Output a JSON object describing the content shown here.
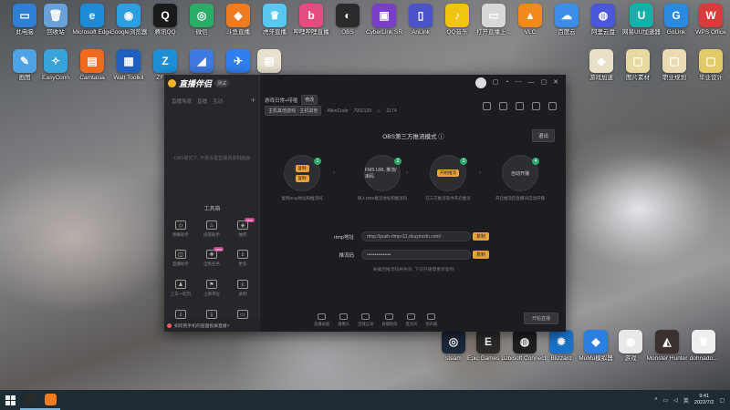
{
  "desktop": {
    "icons": [
      {
        "label": "此电脑",
        "glyph": "▭",
        "color": "#2f7fd6"
      },
      {
        "label": "回收站",
        "glyph": "🗑",
        "color": "#6aa0d8"
      },
      {
        "label": "Microsoft Edge",
        "glyph": "e",
        "color": "#1f8bd8"
      },
      {
        "label": "Google浏览器",
        "glyph": "◉",
        "color": "#2c9fe0"
      },
      {
        "label": "腾讯QQ",
        "glyph": "Q",
        "color": "#1a1a1a"
      },
      {
        "label": "微信",
        "glyph": "◎",
        "color": "#2aae67"
      },
      {
        "label": "斗鱼直播",
        "glyph": "◆",
        "color": "#f07b21"
      },
      {
        "label": "虎牙直播",
        "glyph": "♛",
        "color": "#58c8f0"
      },
      {
        "label": "哔哩哔哩直播",
        "glyph": "b",
        "color": "#e34d7f"
      },
      {
        "label": "OBS",
        "glyph": "◐",
        "color": "#2a2a2a"
      },
      {
        "label": "CyberLink SR",
        "glyph": "▣",
        "color": "#7a3fc8"
      },
      {
        "label": "AnLink",
        "glyph": "▯",
        "color": "#4b53c8"
      },
      {
        "label": "QQ音乐",
        "glyph": "♪",
        "color": "#f1c40f"
      },
      {
        "label": "打开直播上...",
        "glyph": "▭",
        "color": "#d8d8d8"
      },
      {
        "label": "VLC",
        "glyph": "▲",
        "color": "#f08a1c"
      },
      {
        "label": "百度云",
        "glyph": "☁",
        "color": "#3d8ee8"
      },
      {
        "label": "阿里云盘",
        "glyph": "◍",
        "color": "#4a57d8"
      },
      {
        "label": "网易UU加速器",
        "glyph": "U",
        "color": "#16b0a8"
      },
      {
        "label": "GoLink",
        "glyph": "G",
        "color": "#2a8adf"
      },
      {
        "label": "WPS Office",
        "glyph": "W",
        "color": "#d83b3b"
      },
      {
        "label": "画图",
        "glyph": "✎",
        "color": "#4da3e6"
      },
      {
        "label": "EasyConn",
        "glyph": "✧",
        "color": "#38a3d9"
      },
      {
        "label": "Camtasia",
        "glyph": "▤",
        "color": "#f06a1e"
      },
      {
        "label": "Watt Toolkit",
        "glyph": "▦",
        "color": "#1f5fbf"
      },
      {
        "label": "ZFPay",
        "glyph": "Z",
        "color": "#1e8fd6"
      },
      {
        "label": "BlueStacks",
        "glyph": "◢",
        "color": "#3f7ae0"
      },
      {
        "label": "飞书",
        "glyph": "✈",
        "color": "#2f7ff0"
      },
      {
        "label": "文件",
        "glyph": "▤",
        "color": "#e8e2d0"
      },
      {
        "label": "游戏加速",
        "glyph": "◈",
        "color": "#e9e0c8"
      },
      {
        "label": "图片素材",
        "glyph": "▢",
        "color": "#e8d9a0"
      },
      {
        "label": "职业规划",
        "glyph": "▢",
        "color": "#eadbb2"
      },
      {
        "label": "毕业设计",
        "glyph": "▢",
        "color": "#e4c969"
      },
      {
        "label": "steam",
        "glyph": "◎",
        "color": "#1b2838"
      },
      {
        "label": "Epic Games Launcher",
        "glyph": "E",
        "color": "#2a2a2a"
      },
      {
        "label": "Ubisoft Connect",
        "glyph": "◍",
        "color": "#1f1f1f"
      },
      {
        "label": "Blizzard",
        "glyph": "✹",
        "color": "#1a73c8"
      },
      {
        "label": "MuMu模拟器",
        "glyph": "◆",
        "color": "#2a7fe0"
      },
      {
        "label": "游戏",
        "glyph": "◉",
        "color": "#e8e8e8"
      },
      {
        "label": "Monster Hunter",
        "glyph": "◭",
        "color": "#3a3030"
      },
      {
        "label": "dohnado...",
        "glyph": "♛",
        "color": "#eeeeee"
      }
    ]
  },
  "app": {
    "name": "直播伴侣",
    "version": "测试",
    "left": {
      "tabs": [
        "直播场景",
        "直播",
        "互动"
      ],
      "add_glyph": "+",
      "empty_text": "OBS模式下, 不能设置直播场景和画面",
      "tools_title": "工具箱",
      "tools": [
        {
          "label": "弹幕助手",
          "glyph": "◇",
          "is_new": false
        },
        {
          "label": "房管助手",
          "glyph": "♨",
          "is_new": false
        },
        {
          "label": "抽奖",
          "glyph": "◈",
          "is_new": true
        },
        {
          "label": "直播助手",
          "glyph": "◫",
          "is_new": false
        },
        {
          "label": "全民任务",
          "glyph": "✚",
          "is_new": true
        },
        {
          "label": "更多",
          "glyph": "⤓",
          "is_new": false
        },
        {
          "label": "上车一起玩",
          "glyph": "♟",
          "is_new": false
        },
        {
          "label": "上榜带位",
          "glyph": "⚑",
          "is_new": false
        },
        {
          "label": "录制",
          "glyph": "⤓",
          "is_new": false
        },
        {
          "label": "工具",
          "glyph": "⤓",
          "is_new": false
        },
        {
          "label": "工具",
          "glyph": "⤓",
          "is_new": false
        },
        {
          "label": "工具",
          "glyph": "▭",
          "is_new": false
        }
      ],
      "bottom_notice": "如何把手机的画面投屏直播?"
    },
    "top": {
      "icons": [
        "lock-icon",
        "bell-icon",
        "share-icon",
        "minimize-icon",
        "maximize-icon",
        "close-icon"
      ],
      "room_title": "游戏日常+唠嗑",
      "edit_label": "修改",
      "category": "主机其他游戏 · 主机其他",
      "live_code_label": "AllenCode",
      "live_code": "7992139",
      "heat": "2174"
    },
    "obs": {
      "title": "OBS第三方推流模式",
      "exit_label": "退出",
      "steps": [
        {
          "num": "1",
          "buttons": [
            "复制",
            "复制"
          ],
          "text": "",
          "caption": "复制rtmp地址和推流码"
        },
        {
          "num": "2",
          "buttons": [],
          "text": "FMS URL 推流/串码",
          "caption": "填入OBS推流地址和推流码"
        },
        {
          "num": "3",
          "buttons": [
            "开始推流"
          ],
          "text": "",
          "caption": "在三方推流软件开启推流"
        },
        {
          "num": "4",
          "buttons": [],
          "text": "自动开播",
          "caption": "开启推流后直播间自动开播"
        }
      ],
      "fields": [
        {
          "label": "rtmp地址",
          "value": "rtmp://push-rtmp-l11.douyincdn.com/",
          "copy": "复制"
        },
        {
          "label": "推流码",
          "value": "•••••••••••••••",
          "copy": "复制"
        }
      ],
      "tip": "关播后推流码将失效, 下次开播需重新复制"
    },
    "bottom_bar": [
      {
        "label": "直播画面",
        "icon": "screen-icon"
      },
      {
        "label": "摄像头",
        "icon": "camera-icon"
      },
      {
        "label": "连线互动",
        "icon": "link-icon"
      },
      {
        "label": "直播贴纸",
        "icon": "sticker-icon"
      },
      {
        "label": "麦克风",
        "icon": "mic-icon"
      },
      {
        "label": "扬声器",
        "icon": "speaker-icon"
      }
    ],
    "start_label": "开始直播"
  },
  "taskbar": {
    "time": "9:41",
    "date": "2022/7/2",
    "tray_text": "英"
  }
}
